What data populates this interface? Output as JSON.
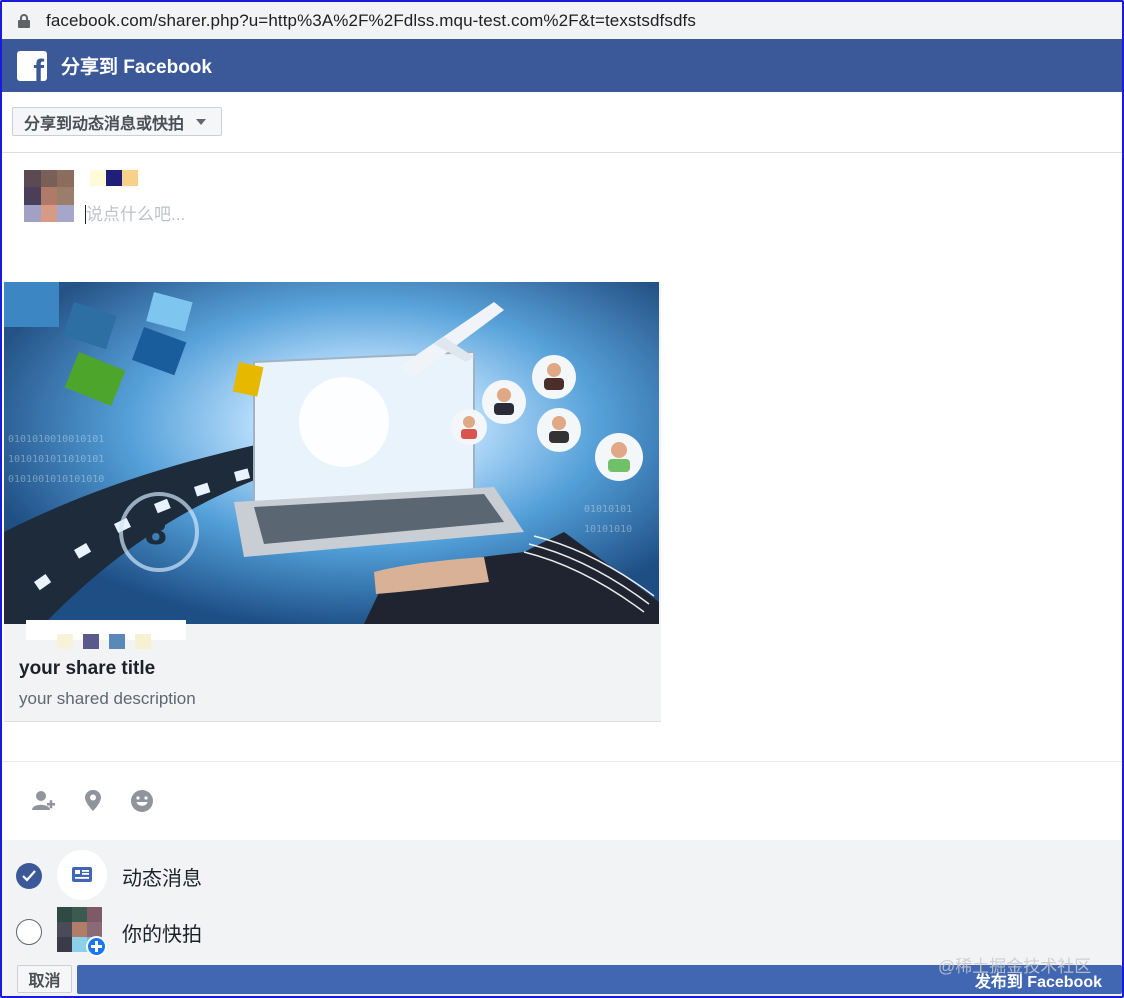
{
  "browser": {
    "url": "facebook.com/sharer.php?u=http%3A%2F%2Fdlss.mqu-test.com%2F&t=texstsdfsdfs"
  },
  "header": {
    "logo_icon": "facebook-f-icon",
    "title": "分享到 Facebook",
    "color": "#3b5998"
  },
  "share_target": {
    "selected": "分享到动态消息或快拍"
  },
  "composer": {
    "placeholder": "说点什么吧...",
    "value": ""
  },
  "preview": {
    "title": "your share title",
    "description": "your shared description"
  },
  "actions": [
    {
      "name": "tag-friends-icon"
    },
    {
      "name": "location-pin-icon"
    },
    {
      "name": "feeling-emoji-icon"
    }
  ],
  "audience": {
    "options": [
      {
        "label": "动态消息",
        "checked": true
      },
      {
        "label": "你的快拍",
        "checked": false
      }
    ]
  },
  "footer": {
    "cancel_label": "取消",
    "publish_label": "发布到 Facebook",
    "accent": "#4267b2"
  },
  "watermark": "@稀土掘金技术社区"
}
